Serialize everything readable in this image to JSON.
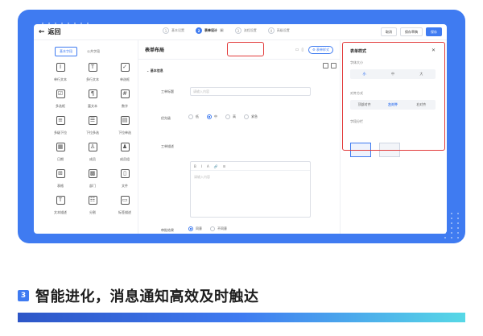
{
  "header": {
    "back_label": "返回",
    "steps": [
      {
        "num": "1",
        "label": "基本设置",
        "active": false
      },
      {
        "num": "2",
        "label": "表单设计",
        "active": true
      },
      {
        "num": "3",
        "label": "流程设置",
        "active": false
      },
      {
        "num": "4",
        "label": "高级设置",
        "active": false
      }
    ],
    "preview_icon": "preview-icon",
    "actions": {
      "cancel": "取消",
      "save_draft": "保存草稿",
      "save": "保存"
    }
  },
  "left_panel": {
    "tabs": [
      {
        "label": "基本字段",
        "active": true
      },
      {
        "label": "公共字段",
        "active": false
      }
    ],
    "fields": [
      {
        "label": "单行文本",
        "icon": "single-line-text-icon",
        "glyph": "I"
      },
      {
        "label": "多行文本",
        "icon": "multi-line-text-icon",
        "glyph": "T"
      },
      {
        "label": "单选框",
        "icon": "radio-icon",
        "glyph": "✓"
      },
      {
        "label": "多选框",
        "icon": "checkbox-icon",
        "glyph": "☑"
      },
      {
        "label": "富文本",
        "icon": "rich-text-icon",
        "glyph": "¶"
      },
      {
        "label": "数字",
        "icon": "number-icon",
        "glyph": "#"
      },
      {
        "label": "多级下拉",
        "icon": "cascade-select-icon",
        "glyph": "≡"
      },
      {
        "label": "下拉多选",
        "icon": "multi-select-icon",
        "glyph": "☰"
      },
      {
        "label": "下拉单选",
        "icon": "single-select-icon",
        "glyph": "▤"
      },
      {
        "label": "日期",
        "icon": "date-icon",
        "glyph": "▦"
      },
      {
        "label": "成员",
        "icon": "member-icon",
        "glyph": "♙"
      },
      {
        "label": "成员组",
        "icon": "member-group-icon",
        "glyph": "♟"
      },
      {
        "label": "表格",
        "icon": "table-icon",
        "glyph": "⊞"
      },
      {
        "label": "部门",
        "icon": "department-icon",
        "glyph": "▩"
      },
      {
        "label": "文件",
        "icon": "file-icon",
        "glyph": "▯"
      },
      {
        "label": "文本描述",
        "icon": "text-description-icon",
        "glyph": "T"
      },
      {
        "label": "分割",
        "icon": "divider-icon",
        "glyph": "☷"
      },
      {
        "label": "标签描述",
        "icon": "tag-description-icon",
        "glyph": "▭"
      }
    ]
  },
  "center_panel": {
    "title": "表单布局",
    "form_style_button": "表单样式",
    "section": "基本信息",
    "fields": {
      "work_title_label": "工单标题",
      "work_title_placeholder": "请输入内容",
      "priority_label": "优先级",
      "priority_options": [
        {
          "label": "低",
          "checked": false
        },
        {
          "label": "中",
          "checked": true
        },
        {
          "label": "高",
          "checked": false
        },
        {
          "label": "紧急",
          "checked": false
        }
      ],
      "description_label": "工单描述",
      "description_placeholder": "请输入内容",
      "editor_tools": [
        "B",
        "I",
        "A",
        "🔗",
        "☰"
      ],
      "approval_label": "审批结果",
      "approval_options": [
        {
          "label": "同意",
          "checked": true
        },
        {
          "label": "不同意",
          "checked": false
        }
      ]
    }
  },
  "right_panel": {
    "title": "表单样式",
    "close_icon": "close-icon",
    "font_size_label": "字体大小",
    "font_sizes": [
      {
        "label": "小",
        "active": true
      },
      {
        "label": "中",
        "active": false
      },
      {
        "label": "大",
        "active": false
      }
    ],
    "align_label": "对齐方式",
    "aligns": [
      {
        "label": "顶部对齐",
        "active": false
      },
      {
        "label": "左对齐",
        "active": true
      },
      {
        "label": "右对齐",
        "active": false
      }
    ],
    "column_label": "字段分栏"
  },
  "heading": {
    "badge": "3",
    "text": "智能进化，消息通知高效及时触达"
  },
  "colors": {
    "brand": "#3f7bf1",
    "highlight": "#e23b3b"
  }
}
